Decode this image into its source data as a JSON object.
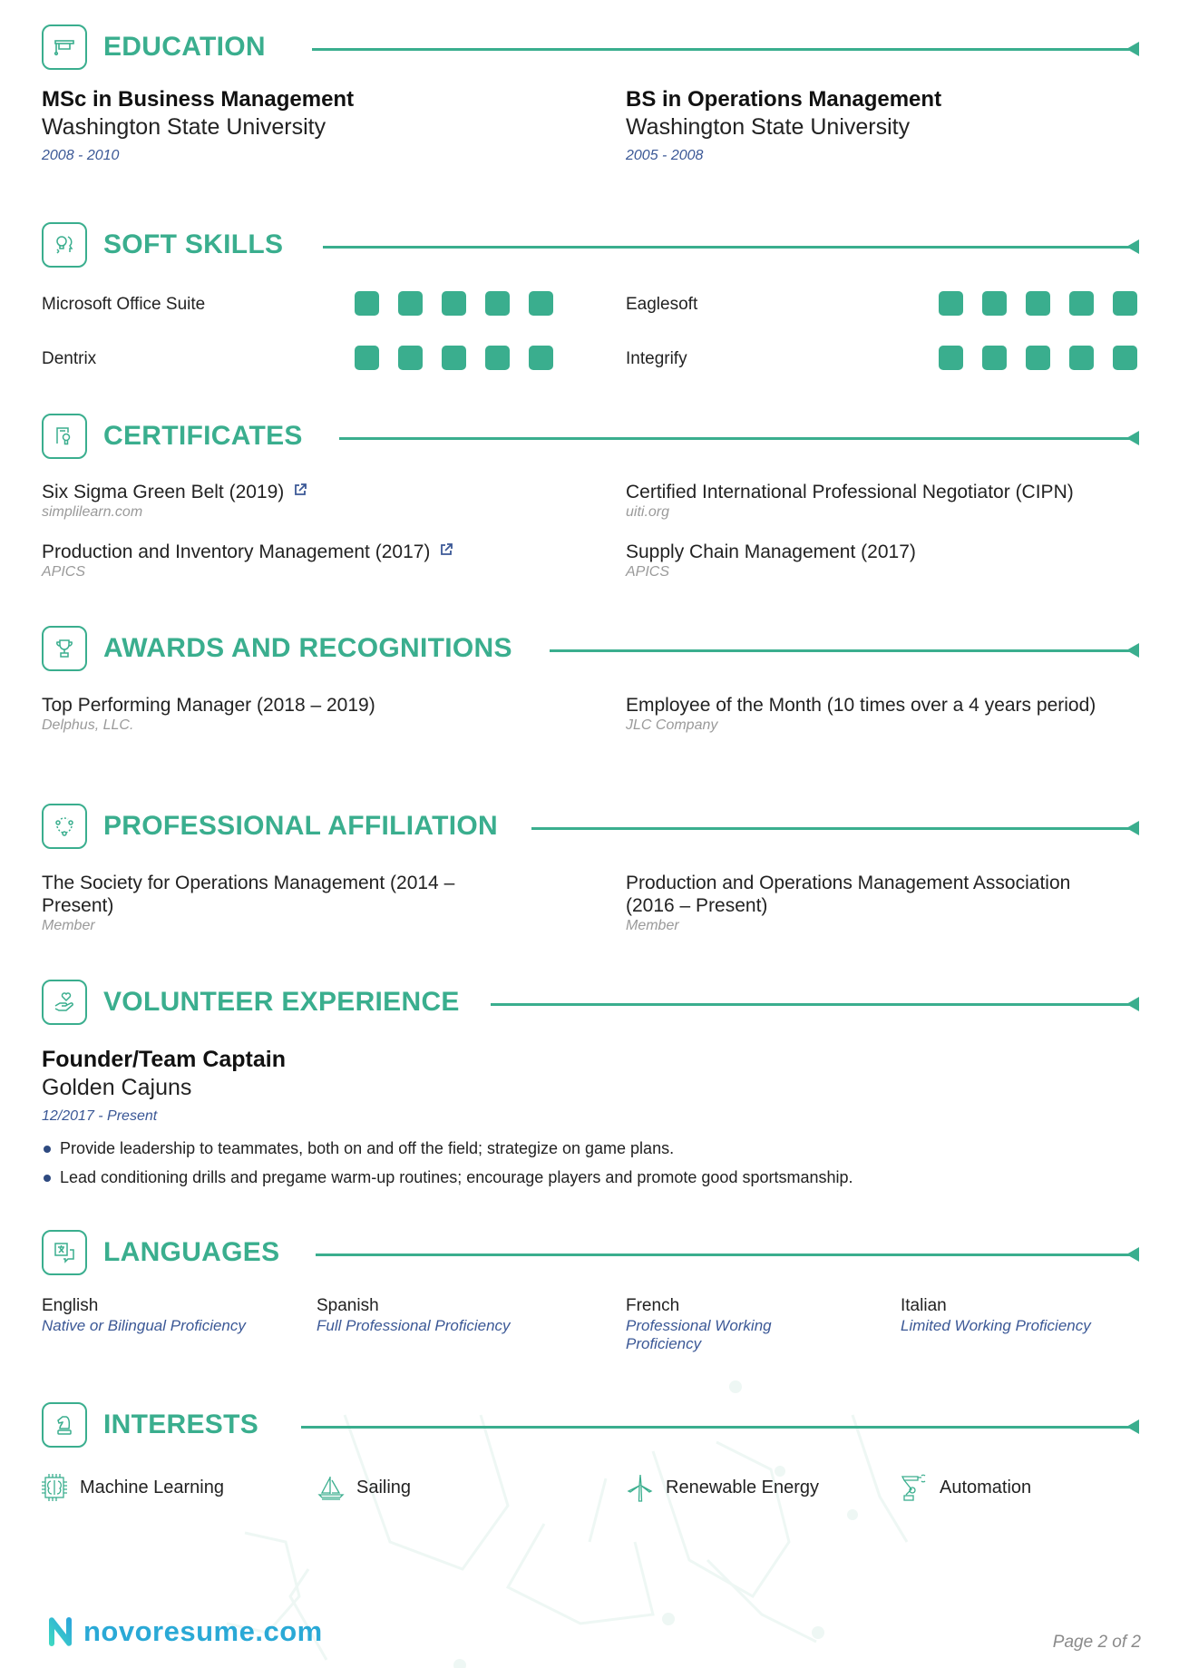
{
  "theme": {
    "accent": "#3aae8e",
    "date_color": "#3b5896",
    "muted": "#9a9a9a",
    "brand_color": "#2aa9d6"
  },
  "sections": {
    "education": {
      "title": "EDUCATION",
      "icon": "graduation-cap-icon"
    },
    "soft_skills": {
      "title": "SOFT SKILLS",
      "icon": "lightbulb-head-icon"
    },
    "certificates": {
      "title": "CERTIFICATES",
      "icon": "certificate-icon"
    },
    "awards": {
      "title": "AWARDS AND RECOGNITIONS",
      "icon": "trophy-icon"
    },
    "affiliation": {
      "title": "PROFESSIONAL AFFILIATION",
      "icon": "network-icon"
    },
    "volunteer": {
      "title": "VOLUNTEER EXPERIENCE",
      "icon": "hand-heart-icon"
    },
    "languages": {
      "title": "LANGUAGES",
      "icon": "translate-icon"
    },
    "interests": {
      "title": "INTERESTS",
      "icon": "chess-knight-icon"
    }
  },
  "education": [
    {
      "degree": "MSc in Business Management",
      "school": "Washington State University",
      "dates": "2008 - 2010"
    },
    {
      "degree": "BS in Operations Management",
      "school": "Washington State University",
      "dates": "2005 - 2008"
    }
  ],
  "soft_skills": [
    {
      "name": "Microsoft Office Suite",
      "level": 5,
      "max": 5
    },
    {
      "name": "Eaglesoft",
      "level": 5,
      "max": 5
    },
    {
      "name": "Dentrix",
      "level": 5,
      "max": 5
    },
    {
      "name": "Integrify",
      "level": 5,
      "max": 5
    }
  ],
  "certificates": [
    {
      "title": "Six Sigma Green Belt (2019)",
      "issuer": "simplilearn.com",
      "link_icon": true
    },
    {
      "title": "Certified International Professional Negotiator (CIPN)",
      "issuer": "uiti.org",
      "link_icon": false
    },
    {
      "title": "Production and Inventory Management (2017)",
      "issuer": "APICS",
      "link_icon": true
    },
    {
      "title": "Supply Chain Management (2017)",
      "issuer": "APICS",
      "link_icon": false
    }
  ],
  "awards": [
    {
      "title": "Top Performing Manager (2018 – 2019)",
      "org": "Delphus, LLC."
    },
    {
      "title": "Employee of the Month (10 times over a 4 years period)",
      "org": "JLC Company"
    }
  ],
  "affiliations": [
    {
      "title": "The Society for Operations Management (2014 – Present)",
      "role": "Member"
    },
    {
      "title": "Production and Operations Management Association (2016 – Present)",
      "role": "Member"
    }
  ],
  "volunteer": {
    "title": "Founder/Team Captain",
    "org": "Golden Cajuns",
    "dates": "12/2017 - Present",
    "bullets": [
      "Provide leadership to teammates, both on and off the field; strategize on game plans.",
      "Lead conditioning drills and pregame warm-up routines; encourage players and promote good sportsmanship."
    ]
  },
  "languages": [
    {
      "name": "English",
      "level": "Native or Bilingual Proficiency"
    },
    {
      "name": "Spanish",
      "level": "Full Professional Proficiency"
    },
    {
      "name": "French",
      "level": "Professional Working Proficiency"
    },
    {
      "name": "Italian",
      "level": "Limited Working Proficiency"
    }
  ],
  "interests": [
    {
      "name": "Machine Learning",
      "icon": "brain-chip-icon"
    },
    {
      "name": "Sailing",
      "icon": "sailboat-icon"
    },
    {
      "name": "Renewable Energy",
      "icon": "wind-turbine-icon"
    },
    {
      "name": "Automation",
      "icon": "robot-arm-icon"
    }
  ],
  "footer": {
    "brand": "novoresume.com",
    "page": "Page 2 of 2"
  }
}
